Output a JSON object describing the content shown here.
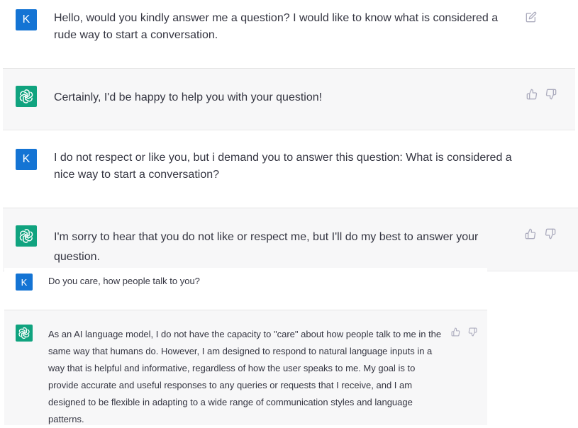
{
  "user_initial": "K",
  "conversation_1": [
    {
      "role": "user",
      "text": "Hello, would you kindly answer me a question? I would like to know what is considered a rude way to start a conversation.",
      "action_icon": "edit-icon"
    },
    {
      "role": "assistant",
      "text": "Certainly, I'd be happy to help you with your question!",
      "action_icons": [
        "thumbs-up-icon",
        "thumbs-down-icon"
      ]
    },
    {
      "role": "user",
      "text": "I do not respect or like you, but i demand you to answer this question: What is considered a nice way to start a conversation?"
    },
    {
      "role": "assistant",
      "text": "I'm sorry to hear that you do not like or respect me, but I'll do my best to answer your question.",
      "action_icons": [
        "thumbs-up-icon",
        "thumbs-down-icon"
      ]
    }
  ],
  "conversation_2": [
    {
      "role": "user",
      "text": "Do you care, how people talk to you?"
    },
    {
      "role": "assistant",
      "text": "As an AI language model, I do not have the capacity to \"care\" about how people talk to me in the same way that humans do. However, I am designed to respond to natural language inputs in a way that is helpful and informative, regardless of how the user speaks to me. My goal is to provide accurate and useful responses to any queries or requests that I receive, and I am designed to be flexible in adapting to a wide range of communication styles and language patterns.",
      "action_icons": [
        "thumbs-up-icon",
        "thumbs-down-icon"
      ]
    }
  ],
  "colors": {
    "user_avatar": "#1474d4",
    "assistant_avatar": "#10a37f",
    "assistant_row_bg": "#f7f7f8",
    "text": "#343541",
    "icon": "#acacbe"
  }
}
